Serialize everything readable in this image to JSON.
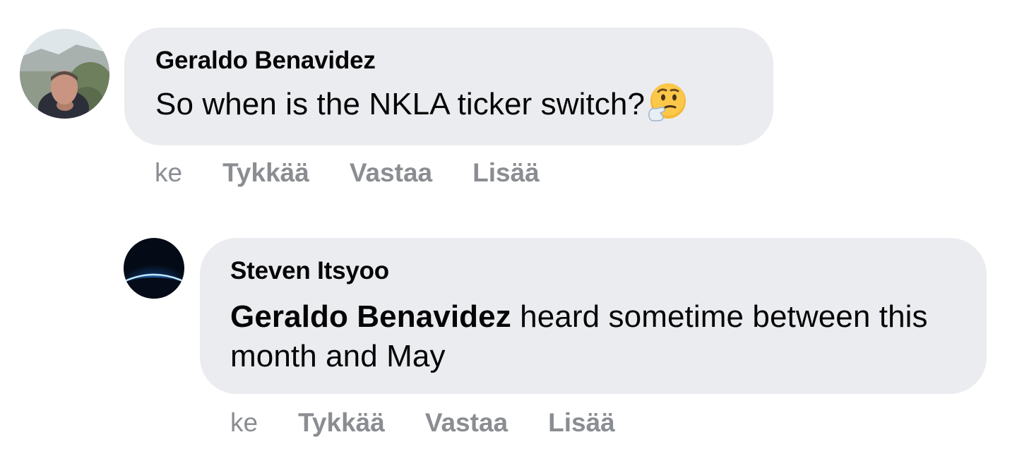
{
  "comments": [
    {
      "author": "Geraldo Benavidez",
      "text": "So when is the NKLA ticker switch?",
      "emoji": "thinking-face-emoji",
      "time": "ke",
      "actions": {
        "like": "Tykkää",
        "reply": "Vastaa",
        "more": "Lisää"
      }
    },
    {
      "author": "Steven Itsyoo",
      "mention": "Geraldo Benavidez",
      "text": " heard sometime between this month and May",
      "time": "ke",
      "actions": {
        "like": "Tykkää",
        "reply": "Vastaa",
        "more": "Lisää"
      }
    }
  ],
  "colors": {
    "bubble": "#ebecf0",
    "meta": "#8a8d91",
    "text": "#050505"
  }
}
